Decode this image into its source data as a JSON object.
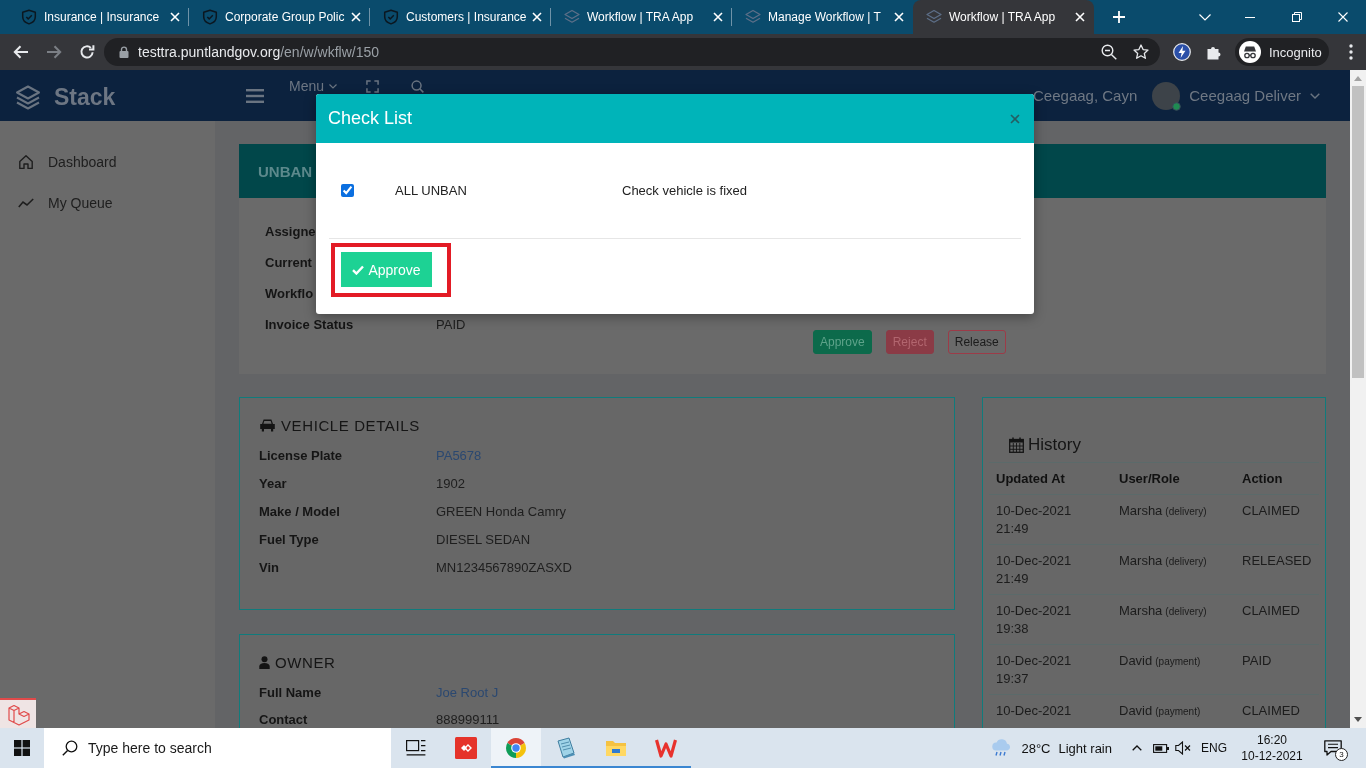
{
  "browser": {
    "tabs": [
      {
        "title": "Insurance | Insurance",
        "kind": "insurance",
        "selected": false
      },
      {
        "title": "Corporate Group Polic",
        "kind": "insurance",
        "selected": false
      },
      {
        "title": "Customers | Insurance",
        "kind": "insurance",
        "selected": false
      },
      {
        "title": "Workflow | TRA App",
        "kind": "workflow",
        "selected": false
      },
      {
        "title": "Manage Workflow | T",
        "kind": "workflow",
        "selected": false
      },
      {
        "title": "Workflow | TRA App",
        "kind": "workflow",
        "selected": true
      }
    ],
    "forward_disabled": true,
    "address": {
      "host": "testtra.puntlandgov.org",
      "path": "/en/w/wkflw/150"
    },
    "profile": "Incognito"
  },
  "app": {
    "brand": "Stack",
    "menu": "Menu",
    "user": {
      "display_name": "Ceegaag, Cayn",
      "account": "Ceegaag Deliver",
      "online": true
    },
    "sidebar": [
      {
        "label": "Dashboard",
        "kind": "dashboard"
      },
      {
        "label": "My Queue",
        "kind": "queue"
      }
    ],
    "workflow_card": {
      "title": "UNBAN",
      "fields": [
        {
          "label": "Assigne"
        },
        {
          "label": "Current"
        },
        {
          "label": "Workflo"
        },
        {
          "label": "Invoice Status",
          "value": "PAID"
        }
      ],
      "actions": [
        {
          "label": "Approve",
          "kind": "approve"
        },
        {
          "label": "Reject",
          "kind": "reject"
        },
        {
          "label": "Release",
          "kind": "release"
        }
      ]
    },
    "vehicle_details": {
      "title": "VEHICLE DETAILS",
      "fields": [
        {
          "label": "License Plate",
          "value": "PA5678",
          "kind": "link"
        },
        {
          "label": "Year",
          "value": "1902",
          "kind": "text"
        },
        {
          "label": "Make / Model",
          "value": "GREEN Honda Camry",
          "kind": "text"
        },
        {
          "label": "Fuel Type",
          "value": "DIESEL SEDAN",
          "kind": "text"
        },
        {
          "label": "Vin",
          "value": "MN1234567890ZASXD",
          "kind": "text"
        }
      ]
    },
    "owner": {
      "title": "OWNER",
      "fields": [
        {
          "label": "Full Name",
          "value": "Joe Root J",
          "kind": "link"
        },
        {
          "label": "Contact",
          "value": "888999111",
          "kind": "text"
        }
      ]
    },
    "history": {
      "title": "History",
      "columns": [
        "Updated At",
        "User/Role",
        "Action"
      ],
      "rows": [
        {
          "updated_at": "10-Dec-2021 21:49",
          "user": "Marsha",
          "role": "(delivery)",
          "action": "CLAIMED"
        },
        {
          "updated_at": "10-Dec-2021 21:49",
          "user": "Marsha",
          "role": "(delivery)",
          "action": "RELEASED"
        },
        {
          "updated_at": "10-Dec-2021 19:38",
          "user": "Marsha",
          "role": "(delivery)",
          "action": "CLAIMED"
        },
        {
          "updated_at": "10-Dec-2021 19:37",
          "user": "David",
          "role": "(payment)",
          "action": "PAID"
        },
        {
          "updated_at": "10-Dec-2021",
          "user": "David",
          "role": "(payment)",
          "action": "CLAIMED"
        }
      ]
    }
  },
  "modal": {
    "title": "Check List",
    "items": [
      {
        "name": "ALL UNBAN",
        "description": "Check vehicle is fixed",
        "checked": true
      }
    ],
    "button": {
      "label": "Approve",
      "highlighted": true
    }
  },
  "taskbar": {
    "search": {
      "placeholder": "Type here to search"
    },
    "apps": [
      {
        "kind": "remote",
        "running": false,
        "active": false
      },
      {
        "kind": "browser",
        "running": true,
        "active": true
      },
      {
        "kind": "notes",
        "running": true,
        "active": false
      },
      {
        "kind": "files",
        "running": true,
        "active": false
      },
      {
        "kind": "office",
        "running": true,
        "active": false
      }
    ],
    "weather": {
      "temperature": "28°C",
      "condition": "Light rain"
    },
    "language": "ENG",
    "time": "16:20",
    "date": "10-12-2021",
    "notifications": "3"
  }
}
